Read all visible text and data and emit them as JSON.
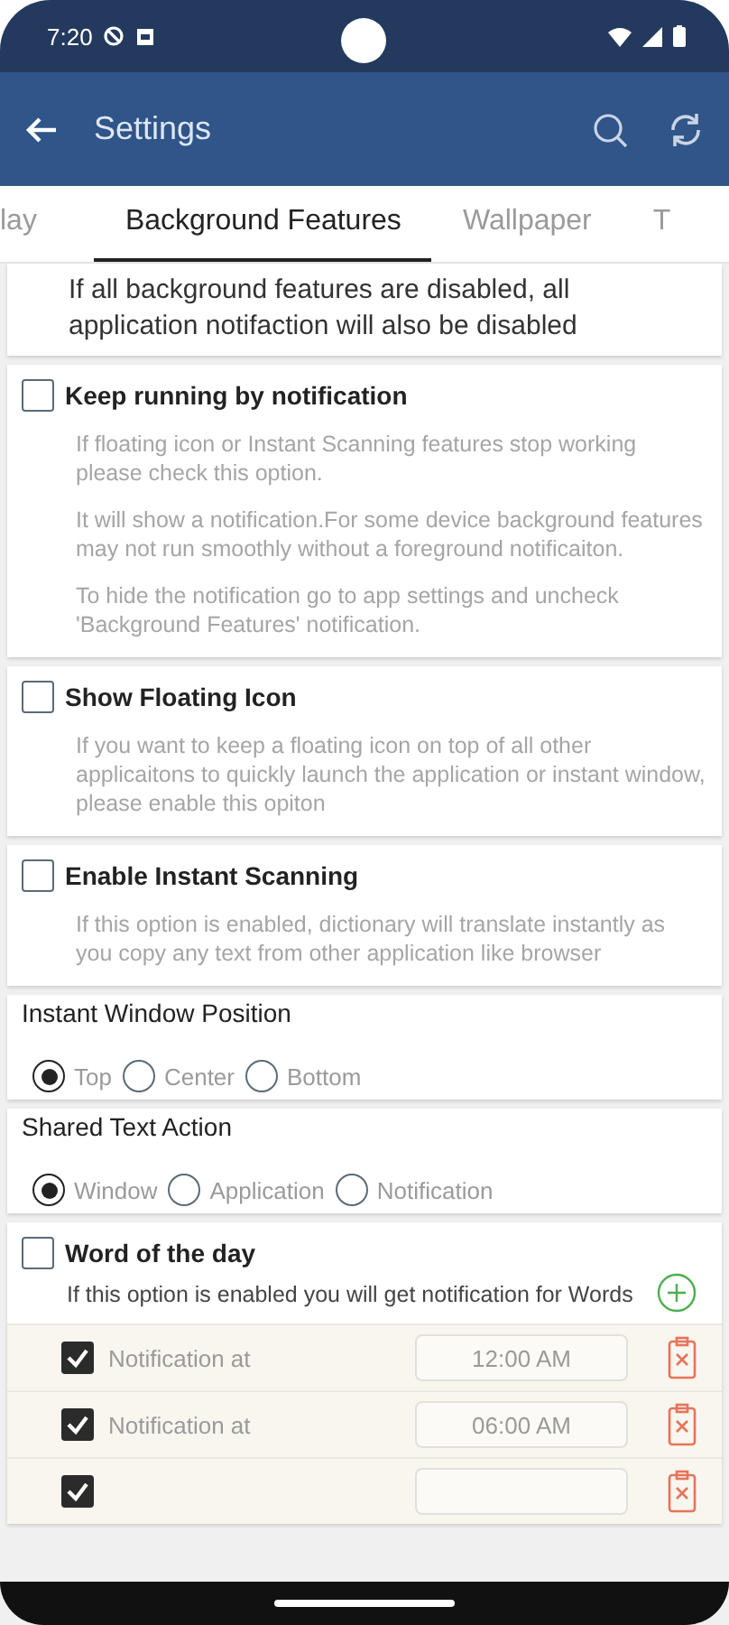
{
  "status_bar": {
    "time": "7:20"
  },
  "app_bar": {
    "title": "Settings"
  },
  "tabs": [
    {
      "label": "lay",
      "selected": false
    },
    {
      "label": "Background Features",
      "selected": true
    },
    {
      "label": "Wallpaper",
      "selected": false
    },
    {
      "label": "T",
      "selected": false
    }
  ],
  "sections": [
    {
      "kind": "note",
      "text": "If all background features are disabled, all application notifaction will also be disabled"
    },
    {
      "kind": "checkbox",
      "label": "Keep running by notification",
      "checked": false,
      "paragraphs": [
        "If floating icon or Instant Scanning features stop working please check this option.",
        "It will show a notification.For some device background features may not run smoothly without a foreground notificaiton.",
        "To hide the notification go to app settings and uncheck 'Background Features' notification."
      ]
    },
    {
      "kind": "checkbox",
      "label": "Show Floating Icon",
      "checked": false,
      "paragraphs": [
        "If you want to keep a floating icon on top of all other applicaitons to quickly launch the application or instant window, please enable this opiton"
      ]
    },
    {
      "kind": "checkbox",
      "label": "Enable Instant Scanning",
      "checked": false,
      "paragraphs": [
        "If this option is enabled, dictionary will translate instantly as you copy any text from other application like browser"
      ]
    },
    {
      "kind": "radio",
      "label": "Instant Window Position",
      "options": [
        {
          "label": "Top",
          "selected": true
        },
        {
          "label": "Center",
          "selected": false
        },
        {
          "label": "Bottom",
          "selected": false
        }
      ]
    },
    {
      "kind": "radio",
      "label": "Shared Text Action",
      "options": [
        {
          "label": "Window",
          "selected": true
        },
        {
          "label": "Application",
          "selected": false
        },
        {
          "label": "Notification",
          "selected": false
        }
      ]
    },
    {
      "kind": "schedule",
      "label": "Word of the day",
      "checked": false,
      "description": "If this option is enabled you will get notification for Words",
      "rows": [
        {
          "label": "Notification at",
          "time": "12:00 AM",
          "checked": true
        },
        {
          "label": "Notification at",
          "time": "06:00 AM",
          "checked": true
        },
        {
          "checked": true
        }
      ]
    }
  ]
}
